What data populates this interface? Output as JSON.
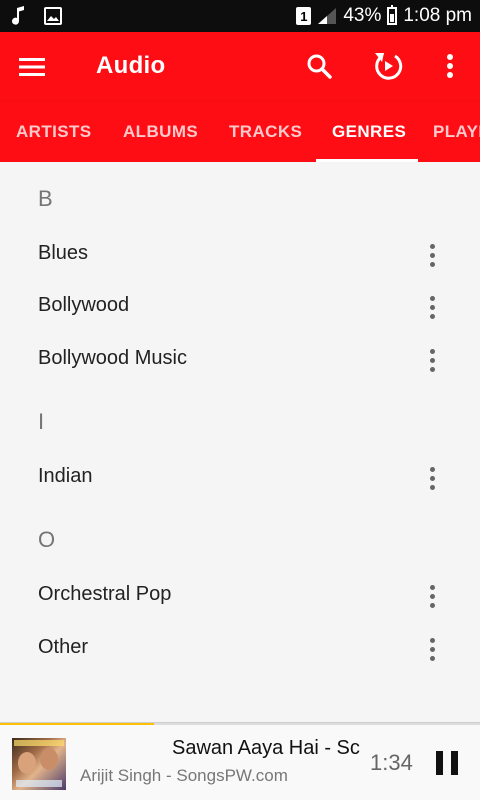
{
  "status_bar": {
    "battery": "43%",
    "time": "1:08 pm",
    "sim": "1",
    "left_icons": [
      "music-note-icon",
      "image-icon"
    ]
  },
  "app_bar": {
    "title": "Audio",
    "color": "#ff0d14",
    "actions": [
      "search-icon",
      "refresh-icon",
      "more-vert-icon"
    ]
  },
  "tabs": [
    {
      "label": "ARTISTS"
    },
    {
      "label": "ALBUMS"
    },
    {
      "label": "TRACKS"
    },
    {
      "label": "GENRES",
      "active": true
    },
    {
      "label": "PLAYL"
    }
  ],
  "sections": [
    {
      "header": "B",
      "items": [
        "Blues",
        "Bollywood",
        "Bollywood Music"
      ]
    },
    {
      "header": "I",
      "items": [
        "Indian"
      ]
    },
    {
      "header": "O",
      "items": [
        "Orchestral Pop",
        "Other"
      ]
    }
  ],
  "now_playing": {
    "title": "Sawan Aaya Hai - Sc",
    "artist": "Arijit Singh - SongsPW.com",
    "time": "1:34",
    "progress": 0.32,
    "progress_color": "#ffc107"
  }
}
